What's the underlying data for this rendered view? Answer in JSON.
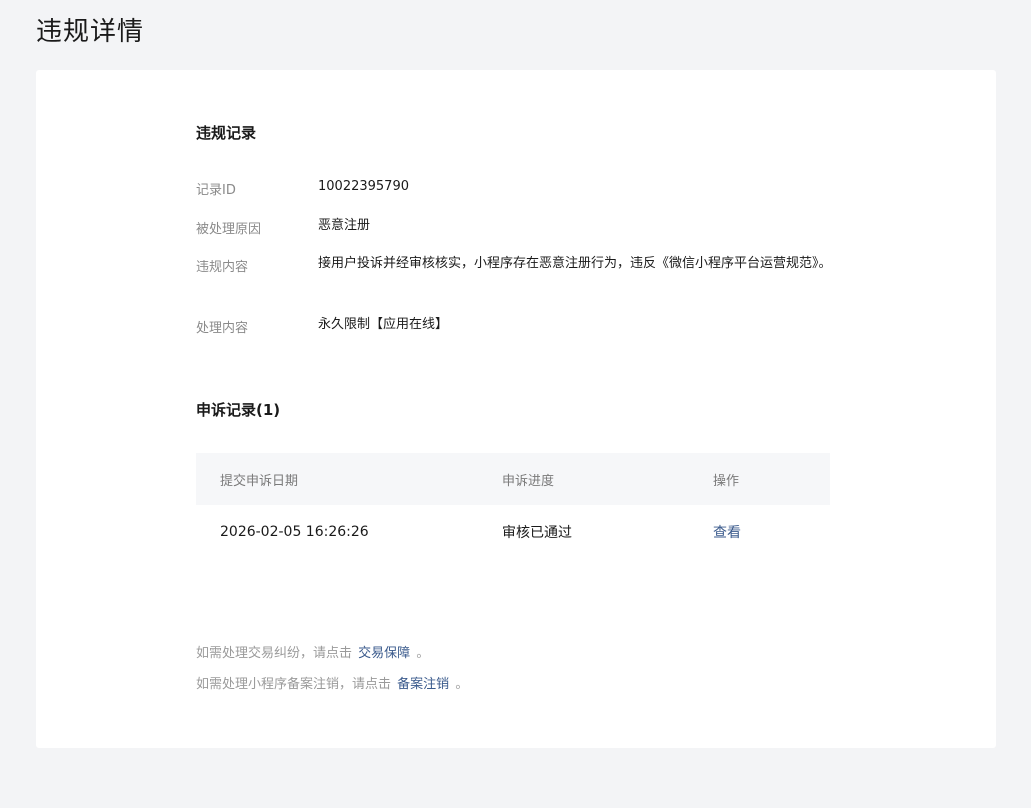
{
  "page": {
    "title": "违规详情"
  },
  "violation": {
    "section_title": "违规记录",
    "fields": [
      {
        "label": "记录ID",
        "value": "10022395790"
      },
      {
        "label": "被处理原因",
        "value": "恶意注册"
      },
      {
        "label": "违规内容",
        "value": "接用户投诉并经审核核实，小程序存在恶意注册行为，违反《微信小程序平台运营规范》。"
      },
      {
        "label": "处理内容",
        "value": "永久限制【应用在线】"
      }
    ]
  },
  "appeal": {
    "section_title": "申诉记录(1)",
    "columns": [
      "提交申诉日期",
      "申诉进度",
      "操作"
    ],
    "rows": [
      {
        "date": "2026-02-05 16:26:26",
        "progress": "审核已通过",
        "action": "查看"
      }
    ]
  },
  "footer": {
    "line1_prefix": "如需处理交易纠纷，请点击",
    "line1_link": "交易保障",
    "line1_suffix": "。",
    "line2_prefix": "如需处理小程序备案注销，请点击",
    "line2_link": "备案注销",
    "line2_suffix": "。"
  },
  "colors": {
    "background": "#f3f4f6",
    "card": "#ffffff",
    "link": "#3a5a8c",
    "label": "#8a8a8a",
    "table_header": "#f6f7f9"
  }
}
